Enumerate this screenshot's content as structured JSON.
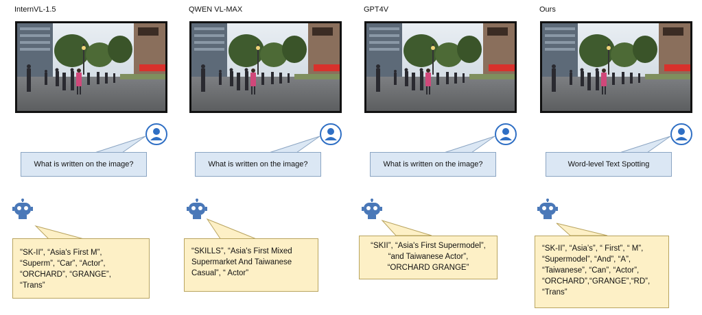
{
  "columns": [
    {
      "title": "InternVL-1.5",
      "question": "What is written on the image?",
      "answer_lines": [
        "\"SK-II\", “Asia's First M”,",
        "“Superm”, “Car”, “Actor”,",
        "“ORCHARD”, “GRANGE”,",
        "“Trans”"
      ]
    },
    {
      "title": "QWEN VL-MAX",
      "question": "What is written on the image?",
      "answer_lines": [
        "“SKILLS”, “Asia's First Mixed",
        "Supermarket And Taiwanese",
        "Casual”, “ Actor”"
      ]
    },
    {
      "title": "GPT4V",
      "question": "What is written on the image?",
      "answer_lines": [
        "“SKII”, “Asia's First Supermodel”,",
        "“and Taiwanese Actor”,",
        "“ORCHARD GRANGE”"
      ]
    },
    {
      "title": "Ours",
      "question": "Word-level Text Spotting",
      "answer_lines": [
        "“SK-II”, “Asia’s”, “ First”, “ M”,",
        "“Supermodel”, “And”, “A”,",
        "“Taiwanese”, “Can”, “Actor”,",
        "“ORCHARD”,“GRANGE”,“RD”,",
        "“Trans”"
      ]
    }
  ],
  "colors": {
    "question_bubble": "#dbe7f4",
    "answer_bubble": "#fdf0c6",
    "user_icon": "#2f6fc4",
    "robot_icon": "#4a78b8"
  },
  "icons": {
    "user": "user-avatar-icon",
    "robot": "robot-icon"
  }
}
